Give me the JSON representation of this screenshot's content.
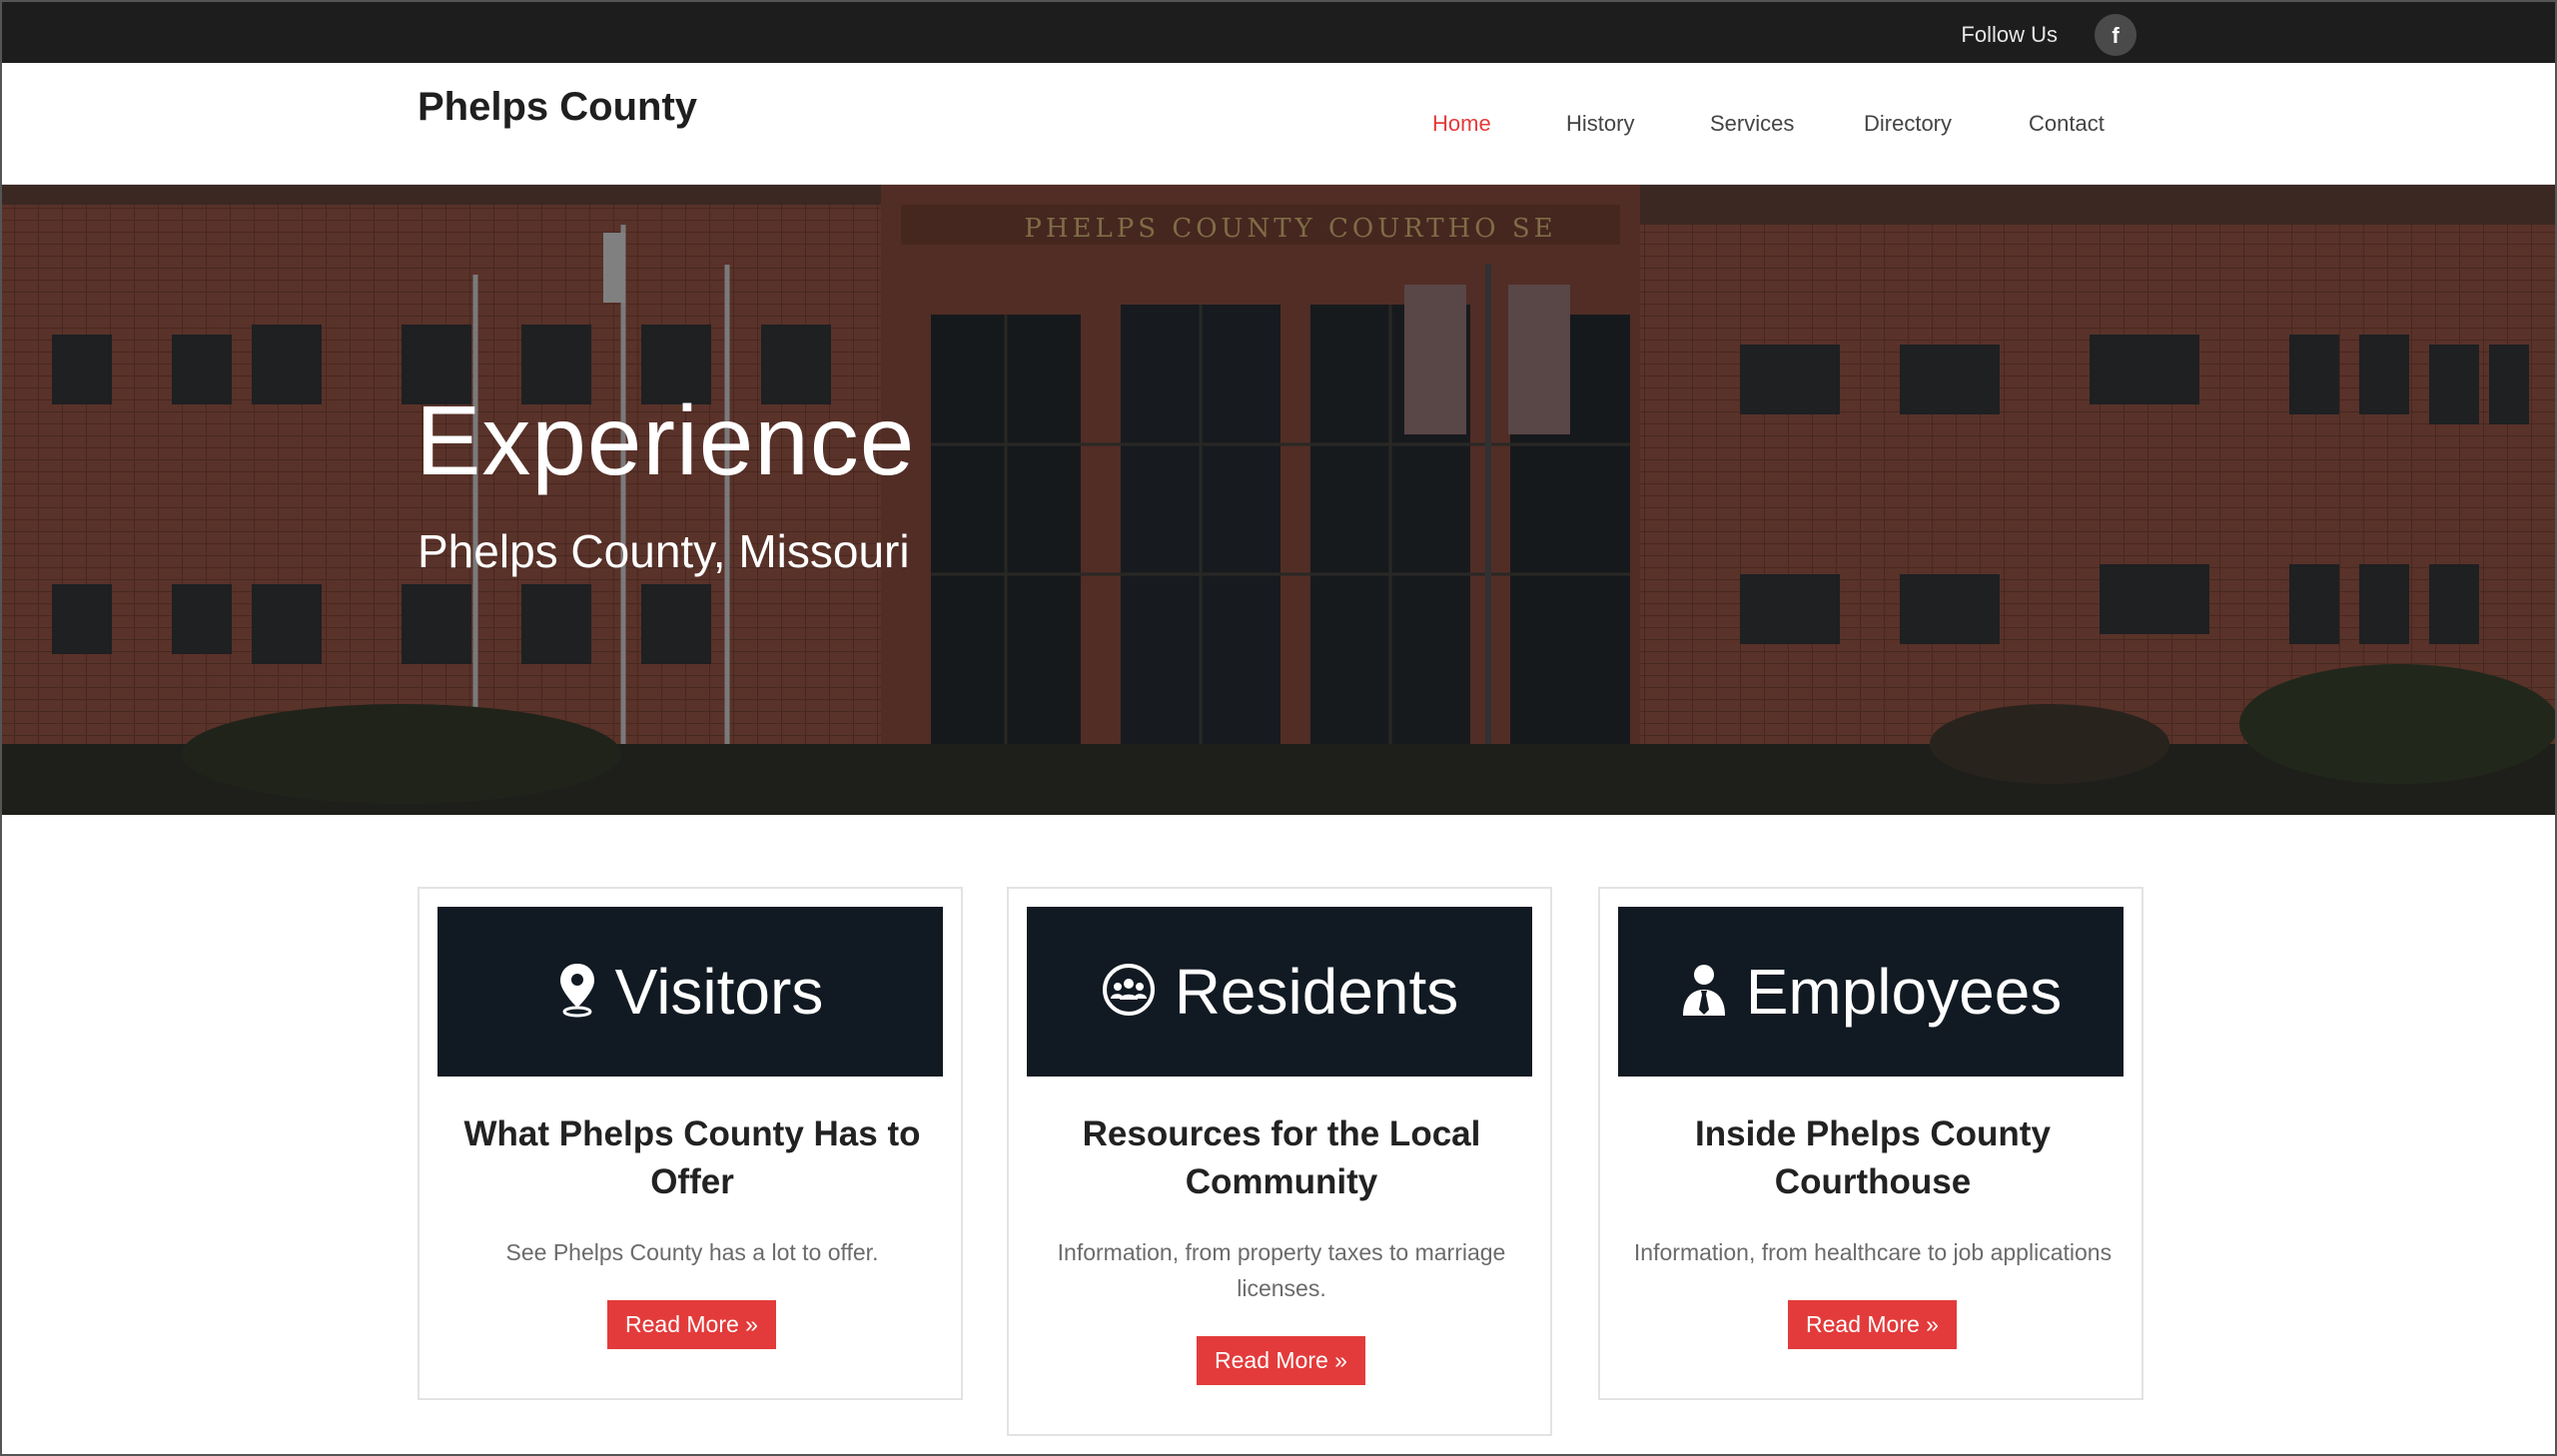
{
  "topbar": {
    "follow_label": "Follow Us",
    "facebook_glyph": "f"
  },
  "header": {
    "site_title": "Phelps County",
    "nav": [
      {
        "label": "Home",
        "active": true
      },
      {
        "label": "History",
        "active": false
      },
      {
        "label": "Services",
        "active": false
      },
      {
        "label": "Directory",
        "active": false
      },
      {
        "label": "Contact",
        "active": false
      }
    ]
  },
  "hero": {
    "title": "Experience",
    "subtitle": "Phelps County, Missouri",
    "building_sign": "PHELPS COUNTY COURTHO SE"
  },
  "cards": [
    {
      "banner_label": "Visitors",
      "icon": "map-pin-icon",
      "heading": "What Phelps County Has to Offer",
      "text": "See Phelps County has a lot to offer.",
      "button": "Read More »"
    },
    {
      "banner_label": "Residents",
      "icon": "group-icon",
      "heading": "Resources for the Local Community",
      "text": "Information, from property taxes to marriage licenses.",
      "button": "Read More »"
    },
    {
      "banner_label": "Employees",
      "icon": "employee-icon",
      "heading": "Inside Phelps County Courthouse",
      "text": "Information, from healthcare to job applications",
      "button": "Read More »"
    }
  ],
  "colors": {
    "accent": "#e33b3b",
    "topbar": "#1d1d1d",
    "banner": "#111a22"
  }
}
